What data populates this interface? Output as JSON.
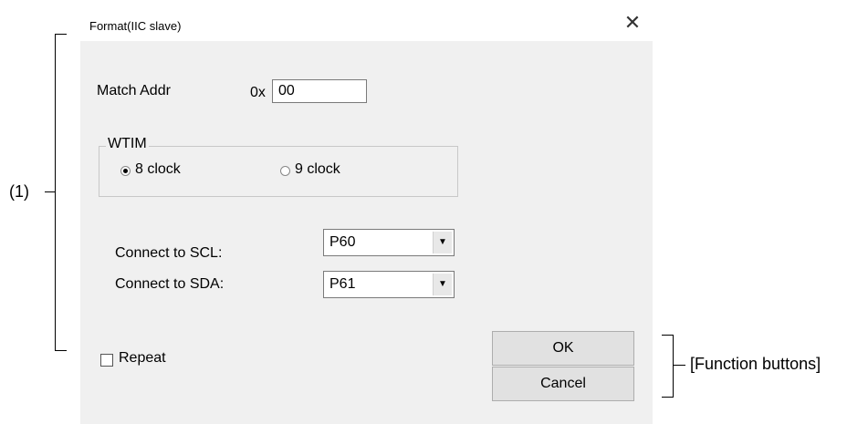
{
  "annotations": {
    "region_1_label": "(1)",
    "function_buttons_label": "[Function buttons]"
  },
  "dialog": {
    "title": "Format(IIC slave)",
    "close_glyph": "✕",
    "match_addr": {
      "label": "Match Addr",
      "prefix": "0x",
      "value": "00"
    },
    "wtim": {
      "legend": "WTIM",
      "options": [
        "8 clock",
        "9 clock"
      ],
      "selected": "8 clock"
    },
    "scl": {
      "label": "Connect to SCL:",
      "value": "P60"
    },
    "sda": {
      "label": "Connect to SDA:",
      "value": "P61"
    },
    "repeat": {
      "label": "Repeat",
      "checked": false
    },
    "buttons": {
      "ok": "OK",
      "cancel": "Cancel"
    }
  }
}
